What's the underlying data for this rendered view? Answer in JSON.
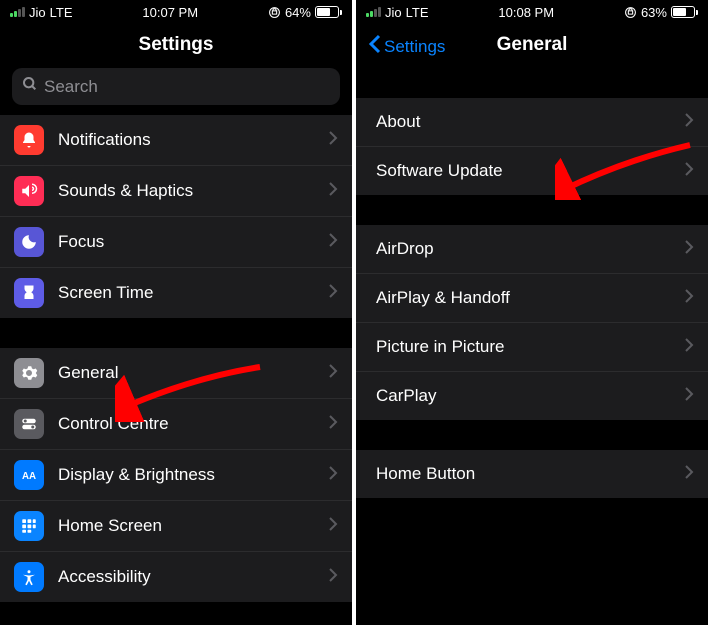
{
  "left": {
    "status": {
      "carrier": "Jio",
      "network": "LTE",
      "time": "10:07 PM",
      "battery_pct": "64%"
    },
    "title": "Settings",
    "search_placeholder": "Search",
    "rows": {
      "notifications": "Notifications",
      "sounds": "Sounds & Haptics",
      "focus": "Focus",
      "screentime": "Screen Time",
      "general": "General",
      "control": "Control Centre",
      "display": "Display & Brightness",
      "home": "Home Screen",
      "accessibility": "Accessibility"
    }
  },
  "right": {
    "status": {
      "carrier": "Jio",
      "network": "LTE",
      "time": "10:08 PM",
      "battery_pct": "63%"
    },
    "back": "Settings",
    "title": "General",
    "rows": {
      "about": "About",
      "software": "Software Update",
      "airdrop": "AirDrop",
      "airplay": "AirPlay & Handoff",
      "pip": "Picture in Picture",
      "carplay": "CarPlay",
      "homebutton": "Home Button"
    }
  }
}
